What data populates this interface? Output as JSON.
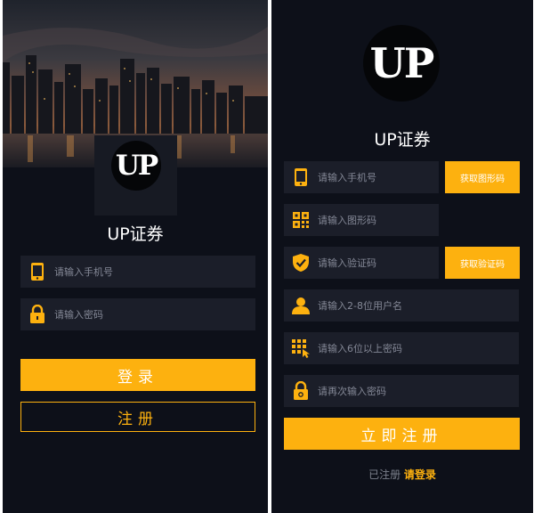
{
  "login": {
    "logo_text": "UP",
    "app_name": "UP证券",
    "phone": {
      "placeholder": "请输入手机号",
      "icon": "phone-icon"
    },
    "password": {
      "placeholder": "请输入密码",
      "icon": "lock-icon"
    },
    "login_label": "登录",
    "register_label": "注册"
  },
  "register": {
    "logo_text": "UP",
    "app_name": "UP证券",
    "fields": [
      {
        "placeholder": "请输入手机号",
        "icon": "phone-icon"
      },
      {
        "placeholder": "请输入图形码",
        "icon": "qr-code-icon"
      },
      {
        "placeholder": "请输入验证码",
        "icon": "shield-check-icon"
      },
      {
        "placeholder": "请输入2-8位用户名",
        "icon": "user-icon"
      },
      {
        "placeholder": "请输入6位以上密码",
        "icon": "keypad-icon"
      },
      {
        "placeholder": "请再次输入密码",
        "icon": "lock-icon"
      }
    ],
    "get_image_code_label": "获取图形码",
    "get_verify_code_label": "获取验证码",
    "submit_label": "立即注册",
    "footer_text": "已注册",
    "footer_link": "请登录"
  },
  "colors": {
    "background": "#0d1019",
    "field": "#1b1e29",
    "accent": "#fdb10f"
  }
}
